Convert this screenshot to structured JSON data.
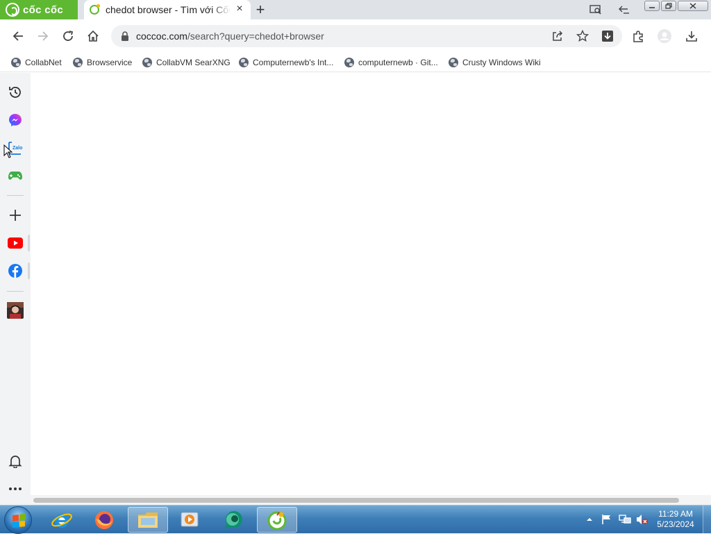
{
  "browser": {
    "brand": "cốc cốc",
    "active_tab": {
      "title": "chedot browser - Tìm với Cốc Cốc",
      "close": "×"
    },
    "new_tab": "+",
    "url": {
      "host": "coccoc.com",
      "rest": "/search?query=chedot+browser"
    },
    "bookmarks": [
      {
        "label": "CollabNet"
      },
      {
        "label": "Browservice"
      },
      {
        "label": "CollabVM SearXNG"
      },
      {
        "label": "Computernewb's Int..."
      },
      {
        "label": "computernewb · Git..."
      },
      {
        "label": "Crusty Windows Wiki"
      }
    ],
    "sidebar": [
      {
        "icon": "history-icon"
      },
      {
        "icon": "messenger-icon"
      },
      {
        "icon": "zalo-icon"
      },
      {
        "icon": "gamepad-icon"
      },
      {
        "icon": "add-icon"
      },
      {
        "icon": "youtube-icon"
      },
      {
        "icon": "facebook-icon"
      },
      {
        "icon": "app-avatar-icon"
      },
      {
        "icon": "bell-icon"
      },
      {
        "icon": "more-icon"
      }
    ],
    "colors": {
      "brand_green": "#5fb832",
      "tabstrip": "#dfe3e8",
      "youtube_red": "#ff0000",
      "facebook_blue": "#1877f2"
    }
  },
  "taskbar": {
    "apps": [
      {
        "icon": "internet-explorer-icon"
      },
      {
        "icon": "firefox-icon"
      },
      {
        "icon": "file-explorer-icon"
      },
      {
        "icon": "media-player-icon"
      },
      {
        "icon": "chat-app-icon"
      },
      {
        "icon": "coccoc-icon"
      }
    ],
    "clock": {
      "time": "11:29 AM",
      "date": "5/23/2024"
    }
  }
}
